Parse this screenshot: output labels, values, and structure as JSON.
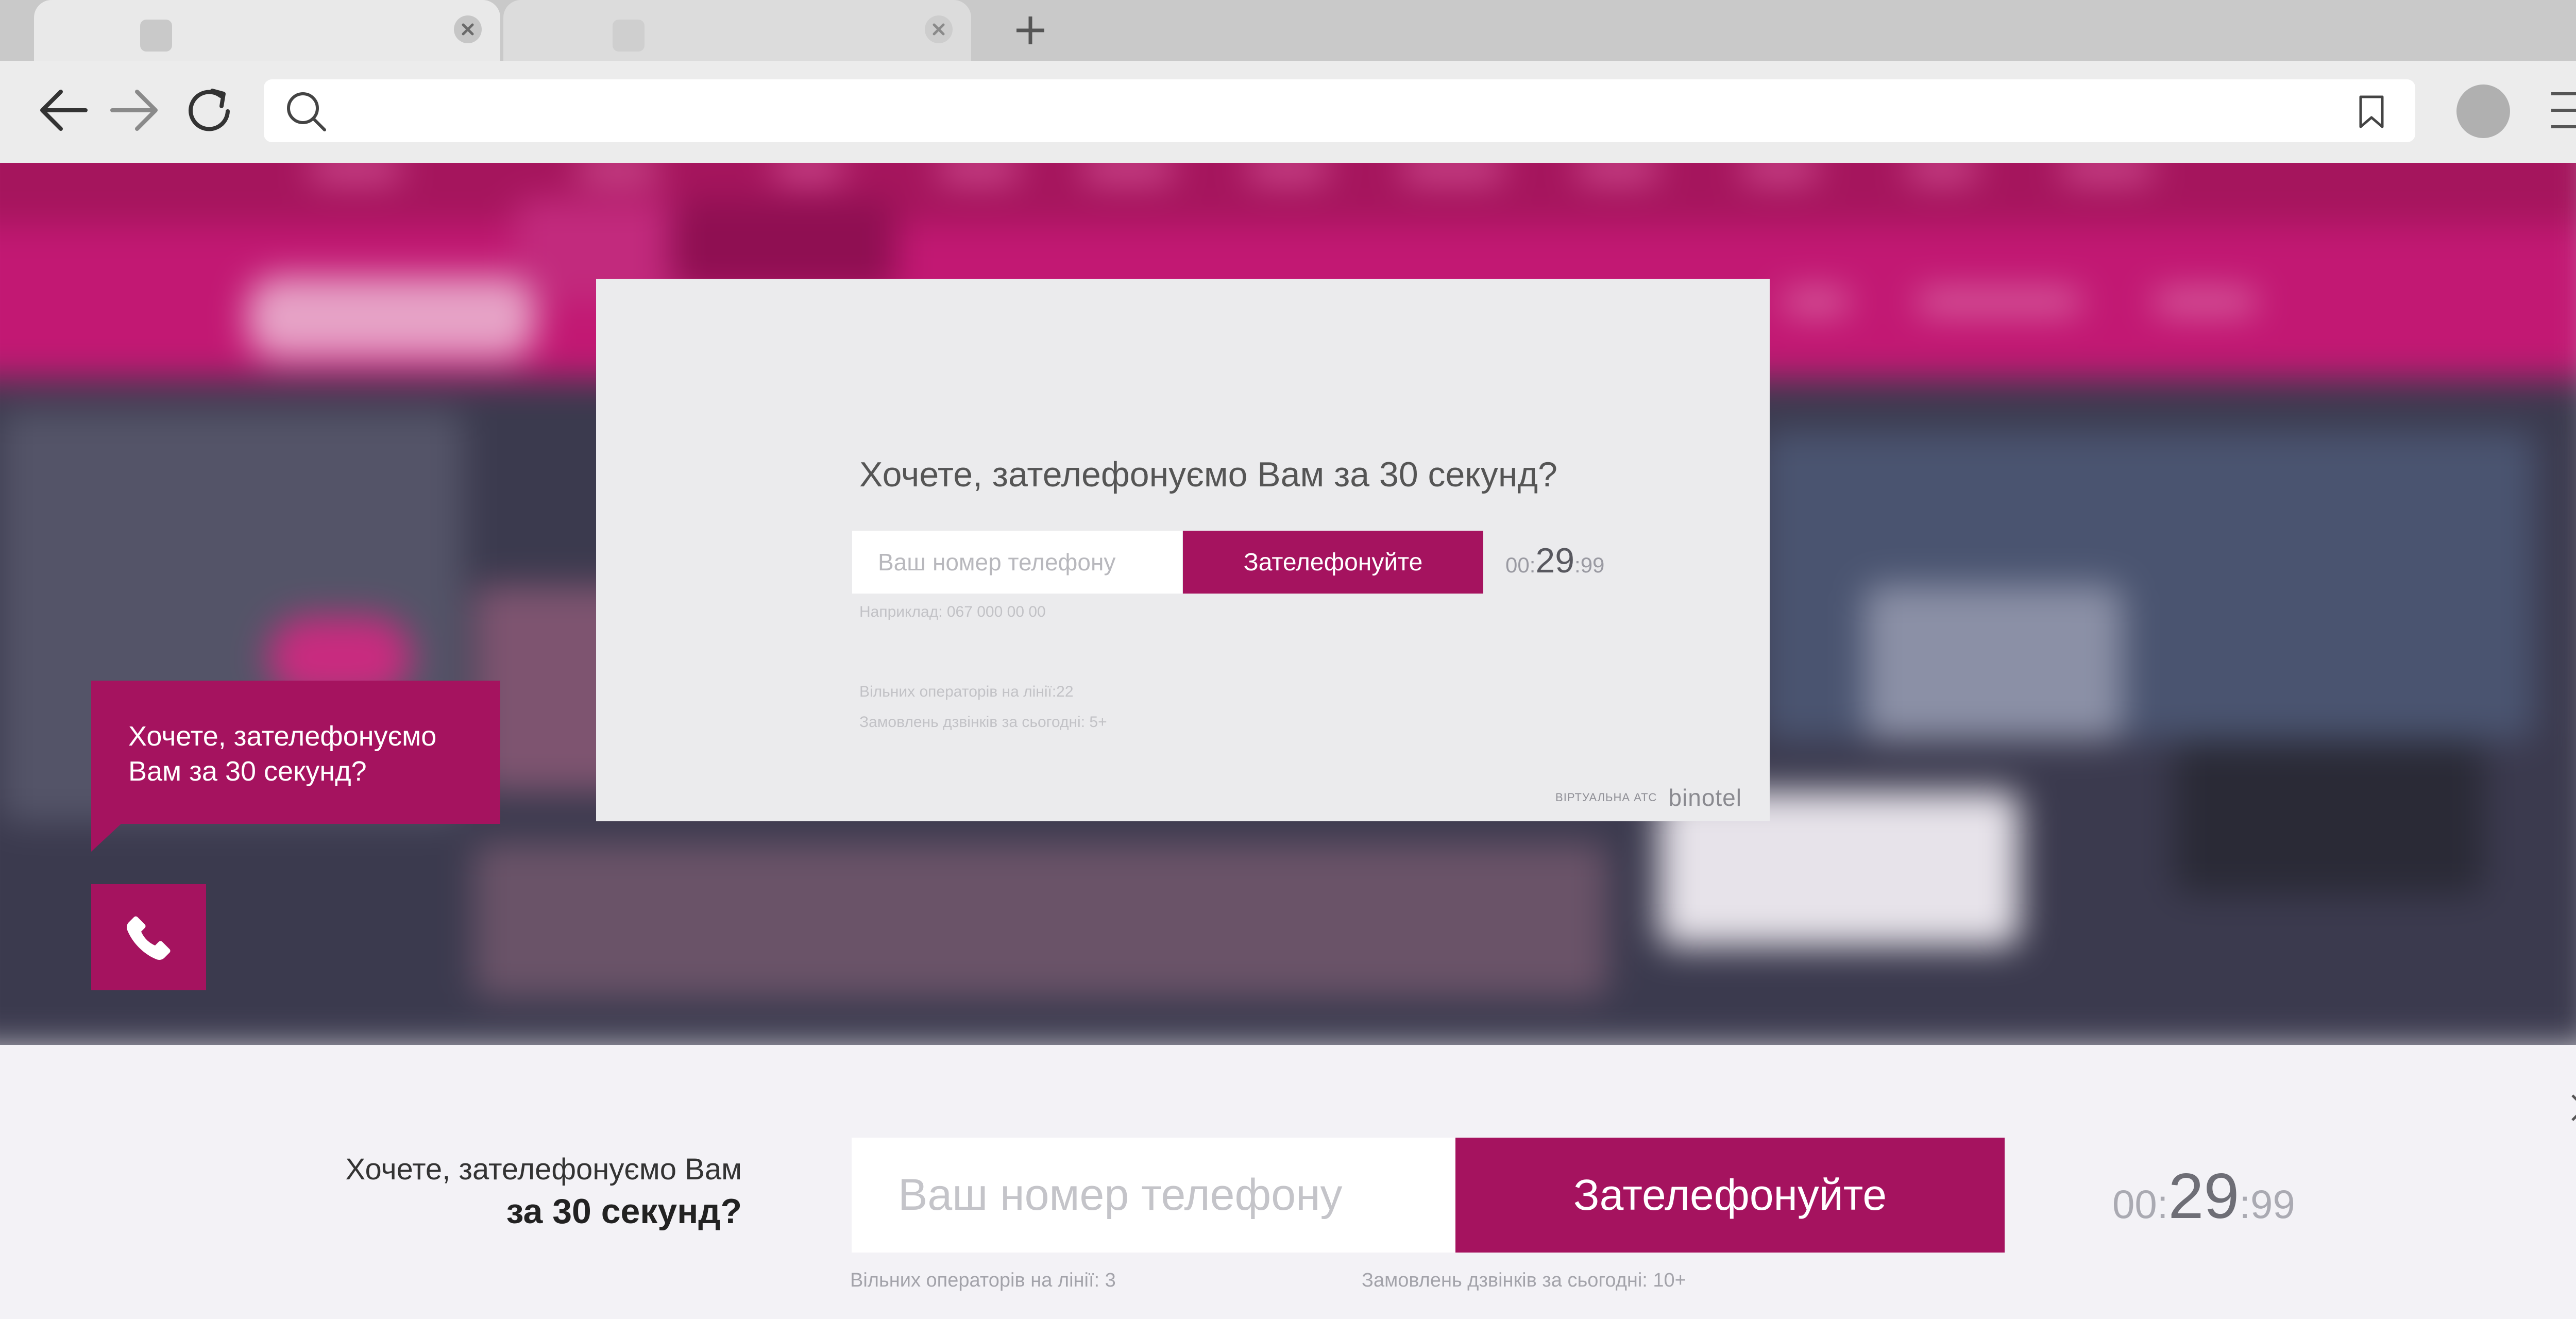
{
  "browser": {
    "tabs": [
      {
        "favicon_icon": "favicon-placeholder"
      },
      {
        "favicon_icon": "favicon-placeholder"
      }
    ],
    "address_bar": {
      "placeholder": "",
      "value": ""
    }
  },
  "modal": {
    "title": "Хочете, зателефонуємо Вам за 30 секунд?",
    "phone_placeholder": "Ваш номер телефону",
    "call_label": "Зателефонуйте",
    "timer": {
      "minutes": "00",
      "seconds": "29",
      "hundredths": "99"
    },
    "example": "Наприклад: 067 000 00 00",
    "operators": "Вільних операторів на лінії:22",
    "orders": "Замовлень дзвінків за сьогодні: 5+",
    "brand_tag": "ВІРТУАЛЬНА АТС",
    "brand_name": "binotel"
  },
  "widget": {
    "bubble_text": "Хочете, зателефонуємо Вам за 30 секунд?"
  },
  "bottom_bar": {
    "question_line1": "Хочете, зателефонуємо Вам",
    "question_line2": "за 30 секунд?",
    "phone_placeholder": "Ваш номер телефону",
    "call_label": "Зателефонуйте",
    "timer": {
      "minutes": "00",
      "seconds": "29",
      "hundredths": "99"
    },
    "operators": "Вільних операторів на лінії: 3",
    "orders": "Замовлень дзвінків за сьогодні: 10+"
  },
  "colors": {
    "brand": "#a5135f",
    "bar_background": "#f3f2f6",
    "modal_background": "#ebebed"
  }
}
